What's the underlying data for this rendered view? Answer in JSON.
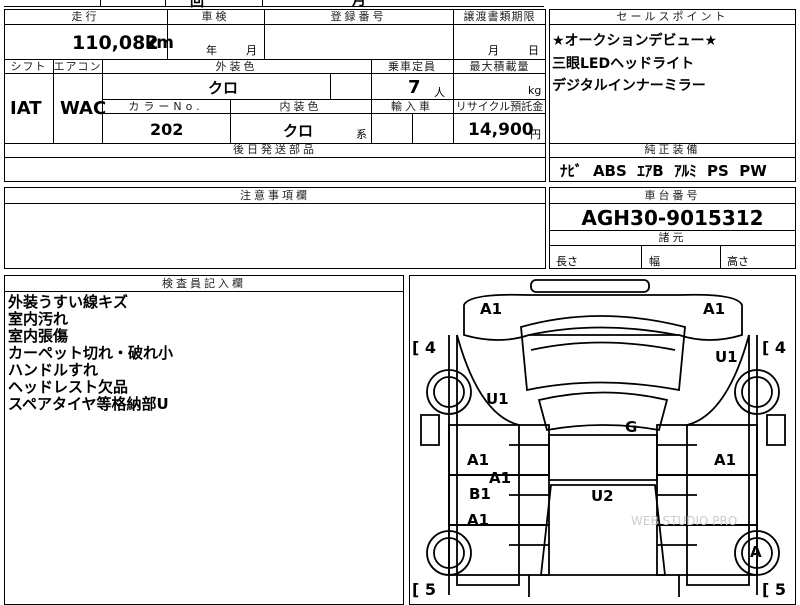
{
  "top_cut_labels": {
    "a": "回",
    "b": "月"
  },
  "headers": {
    "mileage": "走行",
    "shaken": "車検",
    "reg_number": "登録番号",
    "transfer_deadline": "譲渡書類期限",
    "sales_point": "セールスポイント",
    "shift": "シフト",
    "aircon": "エアコン",
    "exterior_color": "外装色",
    "capacity": "乗車定員",
    "max_load": "最大積載量",
    "color_no": "カラーNo.",
    "interior_color": "内装色",
    "import": "輸入車",
    "recycle": "リサイクル預託金",
    "later_parts": "後日発送部品",
    "genuine_equip": "純正装備",
    "caution": "注意事項欄",
    "chassis_no": "車台番号",
    "dimensions": "諸元",
    "inspector": "検査員記入欄"
  },
  "values": {
    "mileage": "110,082",
    "mileage_unit": "km",
    "shaken_year": "年",
    "shaken_month": "月",
    "deadline_month": "月",
    "deadline_day": "日",
    "shift": "IAT",
    "aircon": "WAC",
    "exterior_color": "クロ",
    "capacity": "7",
    "capacity_unit": "人",
    "max_load_unit": "kg",
    "color_no": "202",
    "interior_color": "クロ",
    "interior_suffix": "系",
    "recycle": "14,900",
    "recycle_unit": "円",
    "chassis_no": "AGH30-9015312",
    "dim_length": "長さ",
    "dim_width": "幅",
    "dim_height": "高さ",
    "equipment": "ﾅﾋﾞ  ABS  ｴｱB  ｱﾙﾐ  PS  PW"
  },
  "sales_points": [
    "★オークションデビュー★",
    "三眼LEDヘッドライト",
    "デジタルインナーミラー"
  ],
  "inspector_notes": [
    "外装うすい線キズ",
    "室内汚れ",
    "室内張傷",
    "カーペット切れ・破れ小",
    "ハンドルすれ",
    "ヘッドレスト欠品",
    "スペアタイヤ等格納部U"
  ],
  "diagram": {
    "tire_left_front": "4",
    "tire_right_front": "4",
    "tire_left_rear": "5",
    "tire_right_rear": "5",
    "marks": {
      "front_left": "A1",
      "front_right": "A1",
      "right_fender": "U1",
      "left_fender": "U1",
      "roof": "G",
      "left_door_front": "A1",
      "left_door_front_2": "A1",
      "right_door": "A1",
      "left_rear_door": "B1",
      "left_quarter": "A1",
      "floor": "U2",
      "right_wheel": "A"
    },
    "watermark": "WEB STUDIO PRO"
  }
}
